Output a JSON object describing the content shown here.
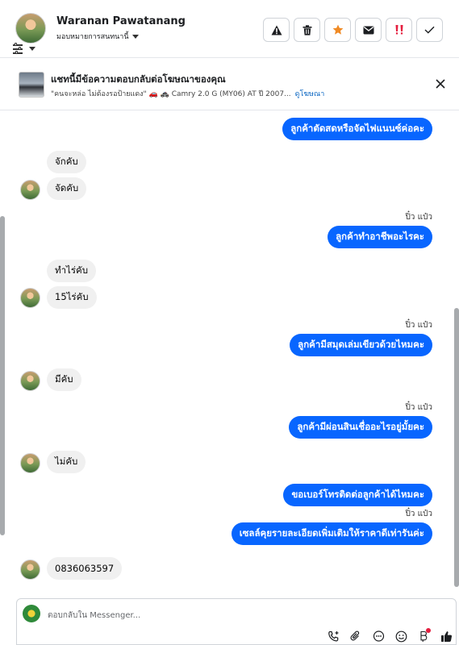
{
  "header": {
    "contact_name": "Waranan Pawatanang",
    "assign_label": "มอบหมายการสนทนานี้"
  },
  "ad": {
    "title": "แชทนี้มีข้อความตอบกลับต่อโฆษณาของคุณ",
    "subtitle": "\"คนจะหล่อ ไม่ต้องรอป้ายแดง\" 🚗 🚓 Camry 2.0 G (MY06) AT ปี 2007...",
    "link_label": "ดูโฆษณา"
  },
  "messages": [
    {
      "direction": "out",
      "text": "ลูกค้าตัดสดหรือจัดไฟแนนซ์ค่อคะ"
    },
    {
      "direction": "in",
      "text": "จักคับ"
    },
    {
      "direction": "in",
      "text": "จัดคับ"
    },
    {
      "direction": "out",
      "sender": "ปิ๋ว แป๋ว",
      "text": "ลูกค้าทำอาชีพอะไรคะ"
    },
    {
      "direction": "in",
      "text": "ทำไร่คับ"
    },
    {
      "direction": "in",
      "text": "15ไร่คับ"
    },
    {
      "direction": "out",
      "sender": "ปิ๋ว แป๋ว",
      "text": "ลูกค้ามีสมุดเล่มเขียวด้วยไหมคะ"
    },
    {
      "direction": "in",
      "text": "มีคับ"
    },
    {
      "direction": "out",
      "sender": "ปิ๋ว แป๋ว",
      "text": "ลูกค้ามีผ่อนสินเชื่ออะไรอยู่มั้ยคะ"
    },
    {
      "direction": "in",
      "text": "ไม่คับ"
    },
    {
      "direction": "out",
      "text": "ขอเบอร์โทรติดต่อลูกค้าได้ไหมคะ"
    },
    {
      "direction": "out",
      "sender": "ปิ๋ว แป๋ว",
      "text": "เซลล์คุยรายละเอียดเพิ่มเติมให้ราคาดีเท่ารันค่ะ"
    },
    {
      "direction": "in",
      "text": "0836063597"
    }
  ],
  "composer": {
    "placeholder": "ตอบกลับใน Messenger..."
  },
  "icons": {
    "report": "warning-icon",
    "delete": "trash-icon",
    "star": "star-icon",
    "mail": "envelope-icon",
    "spam": "double-exclamation-icon",
    "done": "check-icon"
  },
  "colors": {
    "outgoing_bubble": "#0866ff",
    "incoming_bubble": "#f0f0f0",
    "star": "#f08a24",
    "spam": "#e41e3f"
  }
}
